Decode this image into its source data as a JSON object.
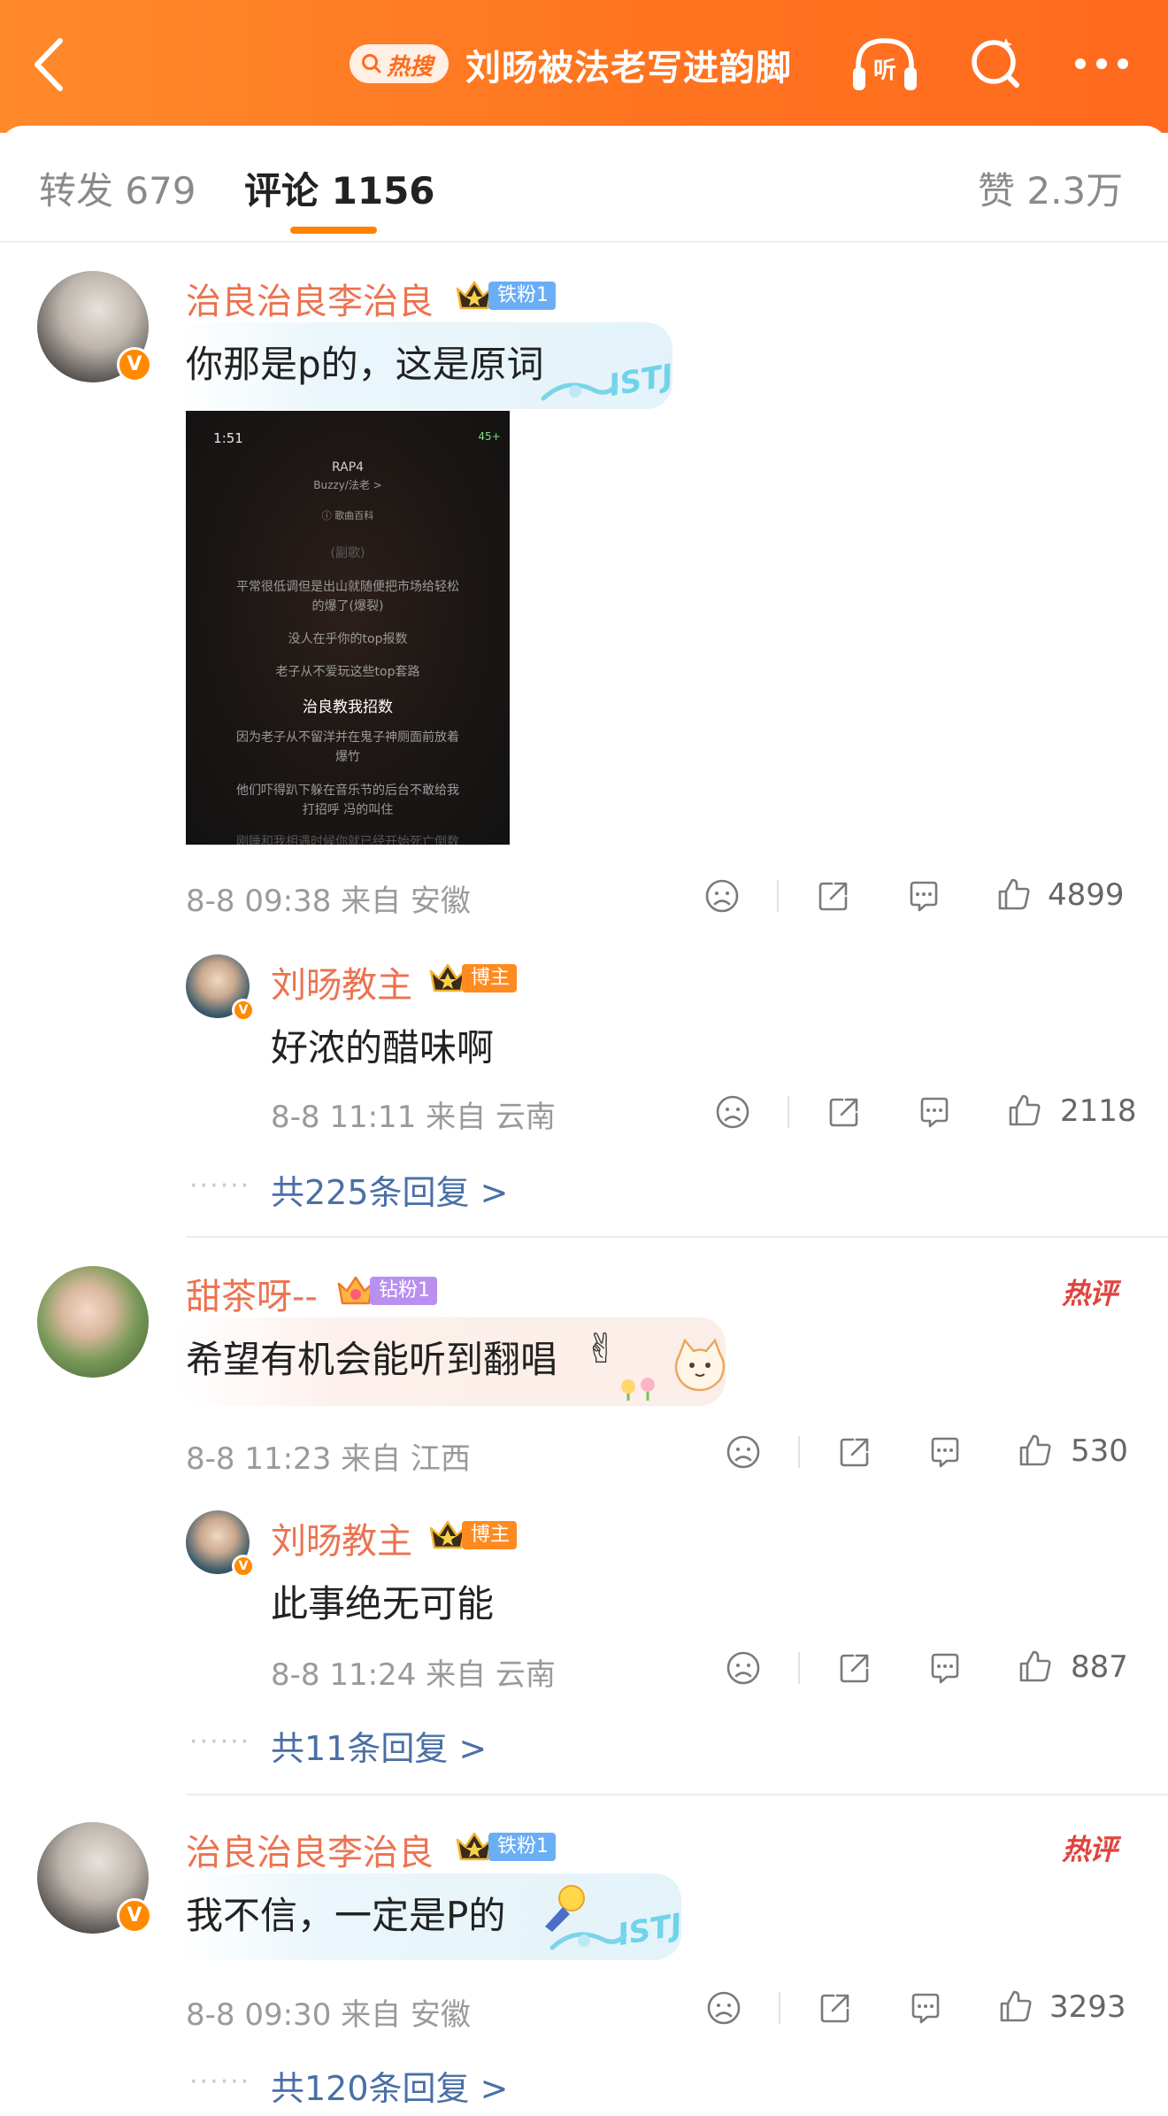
{
  "header": {
    "hot_label": "热搜",
    "topic": "刘旸被法老写进韵脚",
    "listen_label": "听",
    "icons": [
      "back-icon",
      "listen-icon",
      "search-icon",
      "more-icon"
    ],
    "gradient_start": "#ff8a2b",
    "gradient_end": "#ff6a1e"
  },
  "tabs": {
    "repost": "转发 679",
    "comment": "评论 1156",
    "like": "赞 2.3万"
  },
  "screenshot": {
    "time": "1:51",
    "battery": "45+",
    "song": "RAP4",
    "artist": "Buzzy/法老 >",
    "baike": "ⓘ 歌曲百科",
    "lines": [
      "(副歌)",
      "平常很低调但是出山就随便把市场给轻松",
      "的爆了(爆裂)",
      "没人在乎你的top报数",
      "老子从不爱玩这些top套路",
      "治良教我招数",
      "因为老子从不留洋并在鬼子神厕面前放着",
      "爆竹",
      "他们吓得趴下躲在音乐节的后台不敢给我",
      "打招呼 冯的叫住",
      "刚睡和我相遇时候你就已经开始死亡倒数"
    ]
  },
  "comments": [
    {
      "user": "治良治良李治良",
      "badge": "铁粉1",
      "text": "你那是p的，这是原词",
      "deco": "ISTJ",
      "meta": "8-8 09:38 来自 安徽",
      "likes": "4899",
      "reply": {
        "user": "刘旸教主",
        "badge": "博主",
        "text": "好浓的醋味啊",
        "meta": "8-8 11:11 来自 云南",
        "likes": "2118"
      },
      "more": "共225条回复 >"
    },
    {
      "user": "甜茶呀--",
      "badge": "钻粉1",
      "hot": "热评",
      "text": "希望有机会能听到翻唱",
      "meta": "8-8 11:23 来自 江西",
      "likes": "530",
      "reply": {
        "user": "刘旸教主",
        "badge": "博主",
        "text": "此事绝无可能",
        "meta": "8-8 11:24 来自 云南",
        "likes": "887"
      },
      "more": "共11条回复 >"
    },
    {
      "user": "治良治良李治良",
      "badge": "铁粉1",
      "hot": "热评",
      "text": "我不信，一定是P的",
      "deco": "ISTJ",
      "meta": "8-8 09:30 来自 安徽",
      "likes": "3293",
      "more": "共120条回复 >"
    }
  ],
  "colors": {
    "username": "#eb7350",
    "link": "#4a6fa5",
    "hot": "#e0443e",
    "accent": "#ff8200"
  }
}
